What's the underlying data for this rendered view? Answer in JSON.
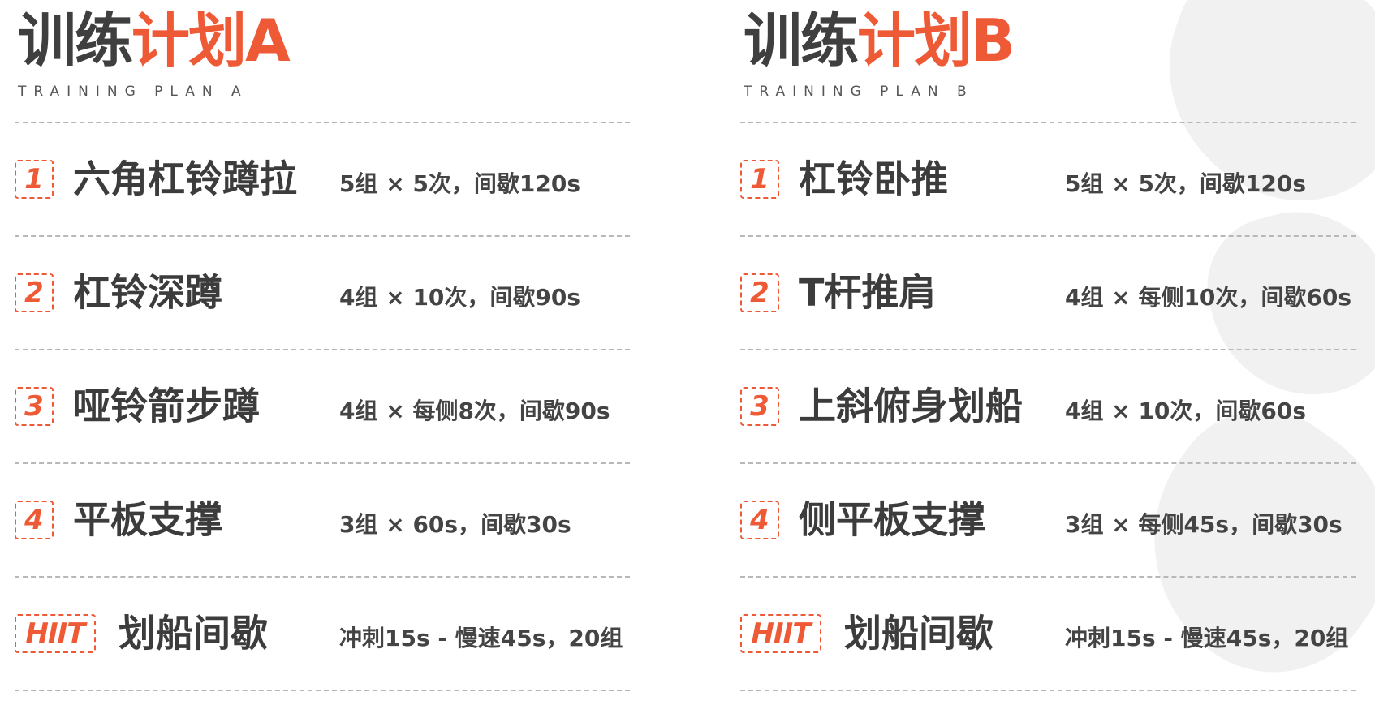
{
  "plans": [
    {
      "title_main": "训练",
      "title_accent": "计划A",
      "subtitle": "TRAINING PLAN A",
      "items": [
        {
          "badge": "1",
          "name": "六角杠铃蹲拉",
          "detail": "5组 × 5次，间歇120s"
        },
        {
          "badge": "2",
          "name": "杠铃深蹲",
          "detail": "4组 × 10次，间歇90s"
        },
        {
          "badge": "3",
          "name": "哑铃箭步蹲",
          "detail": "4组 × 每侧8次，间歇90s"
        },
        {
          "badge": "4",
          "name": "平板支撑",
          "detail": "3组 × 60s，间歇30s"
        },
        {
          "badge": "HIIT",
          "name": "划船间歇",
          "detail": "冲刺15s - 慢速45s，20组"
        }
      ]
    },
    {
      "title_main": "训练",
      "title_accent": "计划B",
      "subtitle": "TRAINING PLAN B",
      "items": [
        {
          "badge": "1",
          "name": "杠铃卧推",
          "detail": "5组 × 5次，间歇120s"
        },
        {
          "badge": "2",
          "name": "T杆推肩",
          "detail": "4组 × 每侧10次，间歇60s"
        },
        {
          "badge": "3",
          "name": "上斜俯身划船",
          "detail": "4组 × 10次，间歇60s"
        },
        {
          "badge": "4",
          "name": "侧平板支撑",
          "detail": "3组 × 每侧45s，间歇30s"
        },
        {
          "badge": "HIIT",
          "name": "划船间歇",
          "detail": "冲刺15s - 慢速45s，20组"
        }
      ]
    }
  ],
  "colors": {
    "accent": "#ee5a36",
    "text": "#3c3c3c",
    "rule": "#b8b8b8"
  }
}
